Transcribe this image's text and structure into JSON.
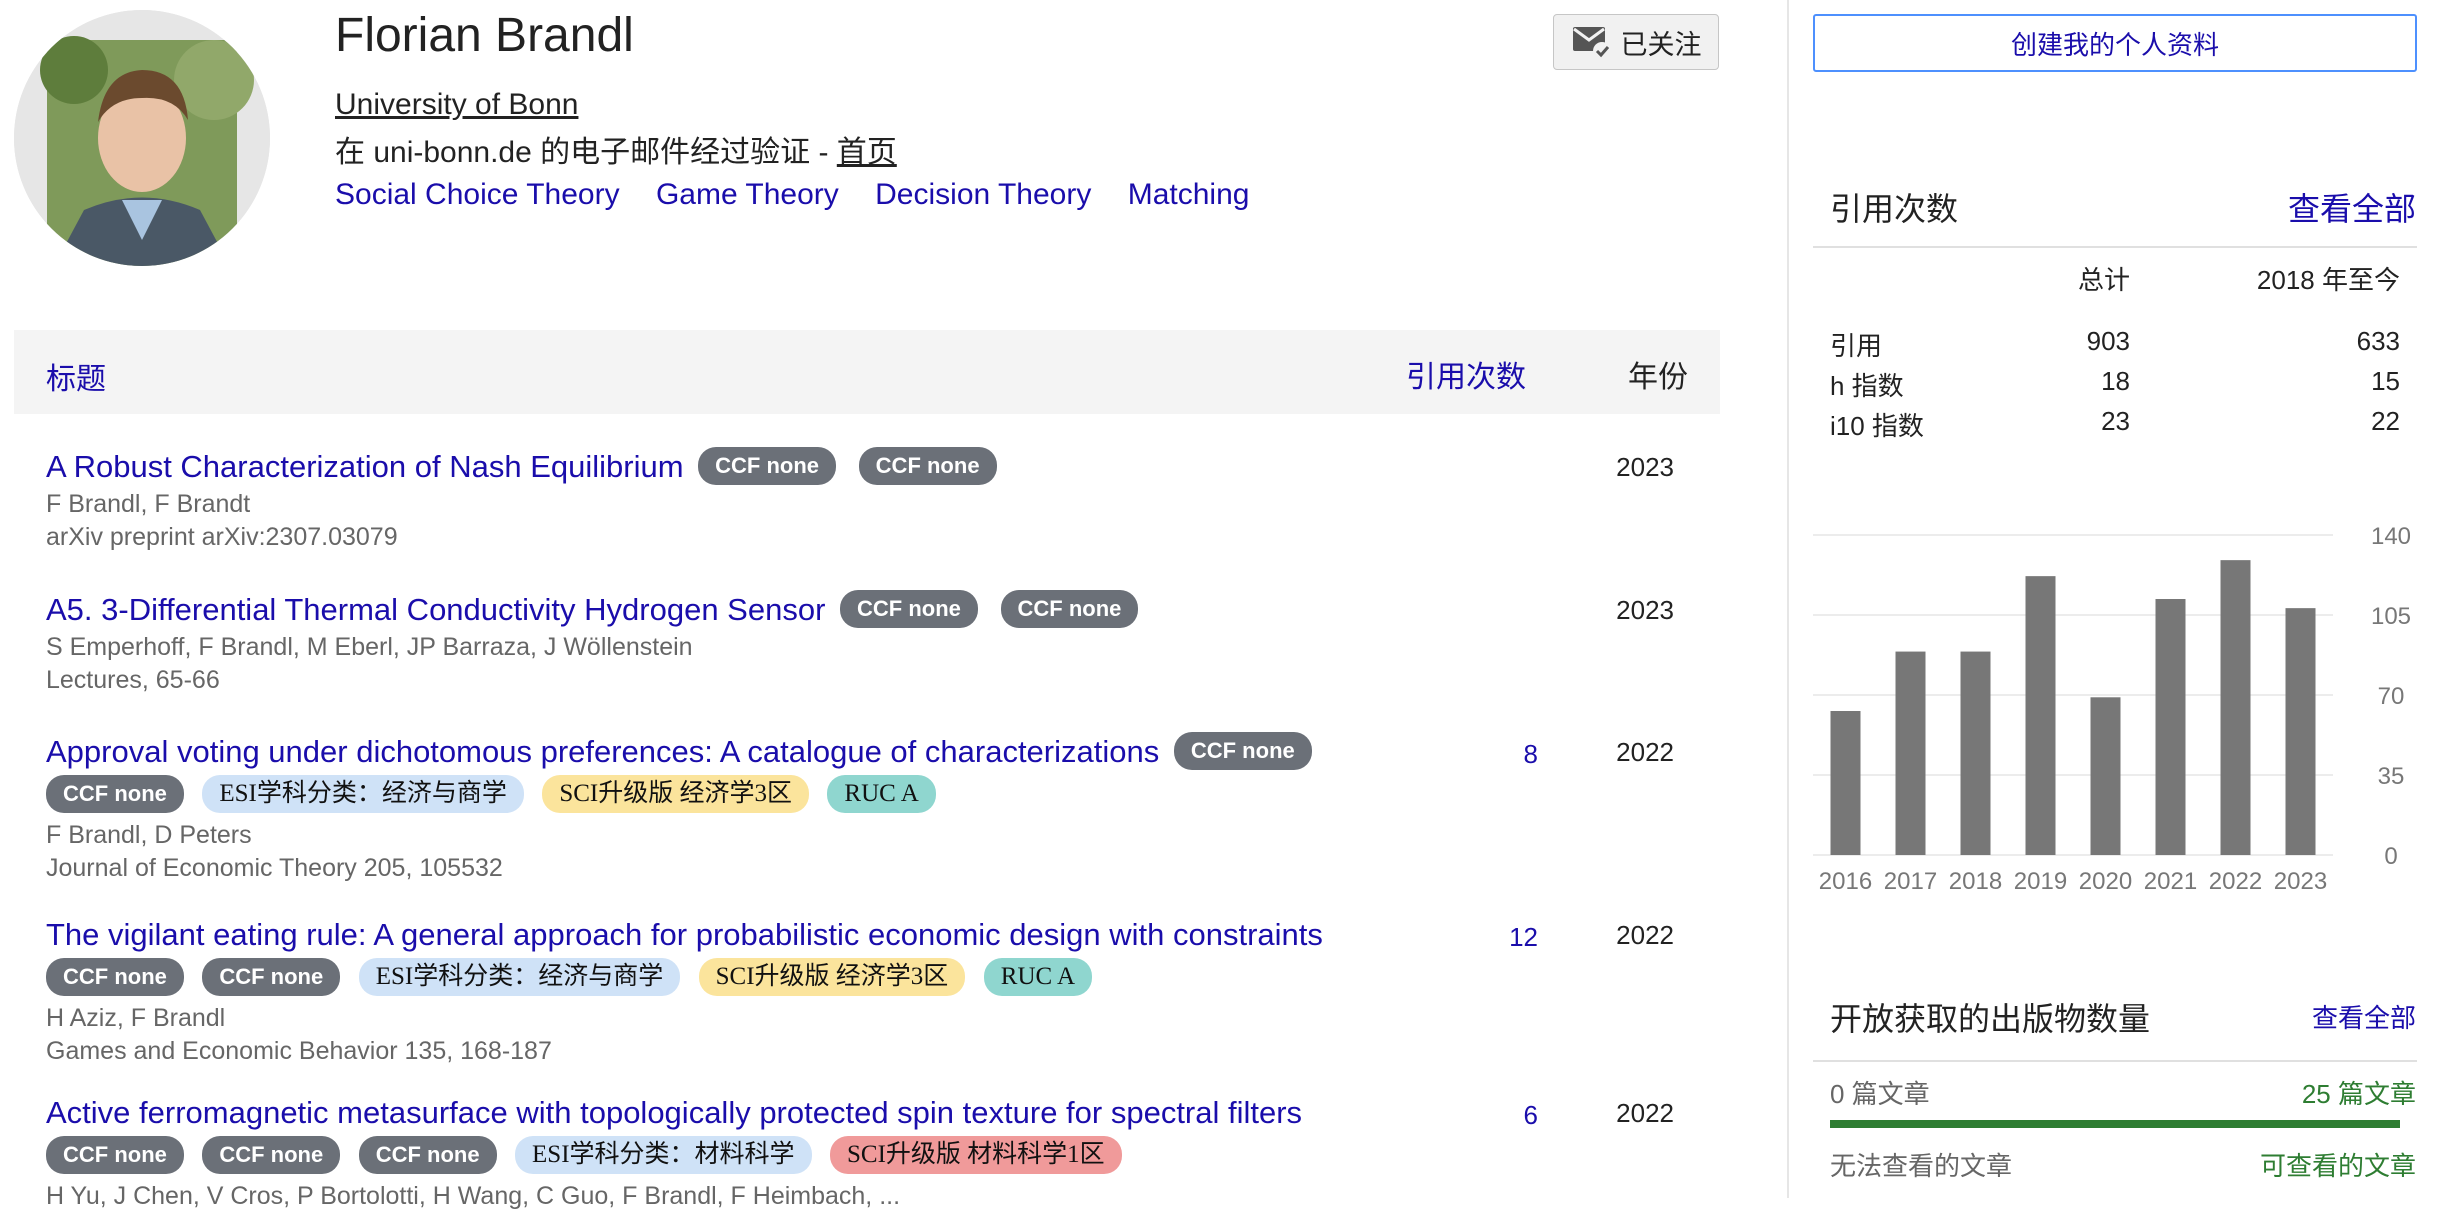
{
  "profile": {
    "name": "Florian Brandl",
    "affiliation": "University of Bonn",
    "verified_prefix": "在 uni-bonn.de 的电子邮件经过验证 - ",
    "homepage_label": "首页",
    "interests": [
      "Social Choice Theory",
      "Game Theory",
      "Decision Theory",
      "Matching"
    ],
    "follow_label": "已关注"
  },
  "table": {
    "header_title": "标题",
    "header_cites": "引用次数",
    "header_year": "年份",
    "rows": [
      {
        "title": "A Robust Characterization of Nash Equilibrium",
        "inline_badges": [
          "CCF none",
          "CCF none"
        ],
        "extra_badges": [],
        "authors": "F Brandl, F Brandt",
        "venue": "arXiv preprint arXiv:2307.03079",
        "cites": "",
        "year": "2023"
      },
      {
        "title": "A5. 3-Differential Thermal Conductivity Hydrogen Sensor",
        "inline_badges": [
          "CCF none",
          "CCF none"
        ],
        "extra_badges": [],
        "authors": "S Emperhoff, F Brandl, M Eberl, JP Barraza, J Wöllenstein",
        "venue": "Lectures, 65-66",
        "cites": "",
        "year": "2023"
      },
      {
        "title": "Approval voting under dichotomous preferences: A catalogue of characterizations",
        "inline_badges": [
          "CCF none"
        ],
        "extra_badges": [
          "CCF none",
          "ESI学科分类：经济与商学",
          "SCI升级版 经济学3区",
          "RUC A"
        ],
        "authors": "F Brandl, D Peters",
        "venue": "Journal of Economic Theory 205, 105532",
        "cites": "8",
        "year": "2022"
      },
      {
        "title": "The vigilant eating rule: A general approach for probabilistic economic design with constraints",
        "inline_badges": [],
        "extra_badges": [
          "CCF none",
          "CCF none",
          "ESI学科分类：经济与商学",
          "SCI升级版 经济学3区",
          "RUC A"
        ],
        "authors": "H Aziz, F Brandl",
        "venue": "Games and Economic Behavior 135, 168-187",
        "cites": "12",
        "year": "2022"
      },
      {
        "title": "Active ferromagnetic metasurface with topologically protected spin texture for spectral filters",
        "inline_badges": [],
        "extra_badges": [
          "CCF none",
          "CCF none",
          "CCF none",
          "ESI学科分类：材料科学",
          "SCI升级版 材料科学1区"
        ],
        "authors": "H Yu, J Chen, V Cros, P Bortolotti, H Wang, C Guo, F Brandl, F Heimbach, ...",
        "venue": "",
        "cites": "6",
        "year": "2022"
      }
    ]
  },
  "sidebar": {
    "create_profile_label": "创建我的个人资料",
    "cited_by_title": "引用次数",
    "view_all_label": "查看全部",
    "stats_header_total": "总计",
    "stats_header_since": "2018 年至今",
    "stats": [
      {
        "label": "引用",
        "total": "903",
        "since": "633"
      },
      {
        "label": "h 指数",
        "total": "18",
        "since": "15"
      },
      {
        "label": "i10 指数",
        "total": "23",
        "since": "22"
      }
    ],
    "open_access_title": "开放获取的出版物数量",
    "open_access_view_all": "查看全部",
    "oa_unavailable_count": "0 篇文章",
    "oa_available_count": "25 篇文章",
    "oa_unavailable_label": "无法查看的文章",
    "oa_available_label": "可查看的文章",
    "oa_available_fraction": 1.0
  },
  "chart_data": {
    "type": "bar",
    "categories": [
      "2016",
      "2017",
      "2018",
      "2019",
      "2020",
      "2021",
      "2022",
      "2023"
    ],
    "values": [
      63,
      89,
      89,
      122,
      69,
      112,
      129,
      108
    ],
    "yticks": [
      "0",
      "35",
      "70",
      "105",
      "140"
    ],
    "ylim": [
      0,
      140
    ],
    "axis_position": "right",
    "grid": true,
    "bar_color": "#777777"
  }
}
